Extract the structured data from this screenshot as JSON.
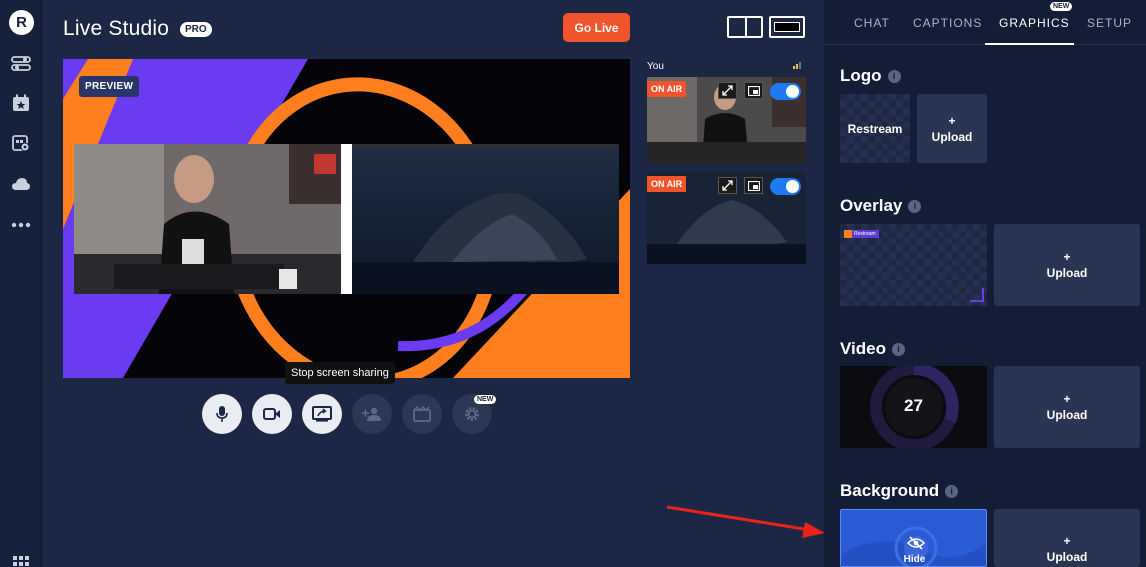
{
  "app": {
    "title": "Live Studio",
    "badge": "PRO",
    "logo_letter": "R",
    "go_live_label": "Go Live"
  },
  "sidebar": {
    "items": [
      {
        "icon": "toggles-icon"
      },
      {
        "icon": "star-calendar-icon"
      },
      {
        "icon": "calendar-settings-icon"
      },
      {
        "icon": "cloud-icon"
      },
      {
        "icon": "more-dots-icon"
      },
      {
        "icon": "grid-icon"
      }
    ]
  },
  "stage": {
    "preview_label": "PREVIEW"
  },
  "controls": {
    "tooltip": "Stop screen sharing",
    "new_badge": "NEW",
    "buttons": [
      {
        "icon": "microphone-icon",
        "state": "on"
      },
      {
        "icon": "camera-icon",
        "state": "on"
      },
      {
        "icon": "screen-share-icon",
        "state": "on"
      },
      {
        "icon": "add-guest-icon",
        "state": "off"
      },
      {
        "icon": "video-clip-icon",
        "state": "off"
      },
      {
        "icon": "settings-gear-icon",
        "state": "off"
      }
    ]
  },
  "participants": {
    "you_label": "You",
    "on_air_label": "ON AIR"
  },
  "panel": {
    "tabs": [
      "CHAT",
      "CAPTIONS",
      "GRAPHICS",
      "SETUP"
    ],
    "active_tab": "GRAPHICS",
    "graphics_new_badge": "NEW",
    "logo": {
      "title": "Logo",
      "item_text": "Restream"
    },
    "overlay": {
      "title": "Overlay",
      "mini_label": "Restream"
    },
    "video": {
      "title": "Video",
      "countdown": "27"
    },
    "background": {
      "title": "Background",
      "hover_label": "Hide"
    },
    "upload": {
      "plus": "+",
      "label": "Upload"
    }
  },
  "colors": {
    "accent_orange": "#f0542d",
    "brand_blue": "#1d7af2",
    "panel_bg": "#131d36",
    "app_bg": "#1b2744",
    "preview_purple": "#6a3bf0",
    "preview_orange": "#ff7f1f"
  }
}
